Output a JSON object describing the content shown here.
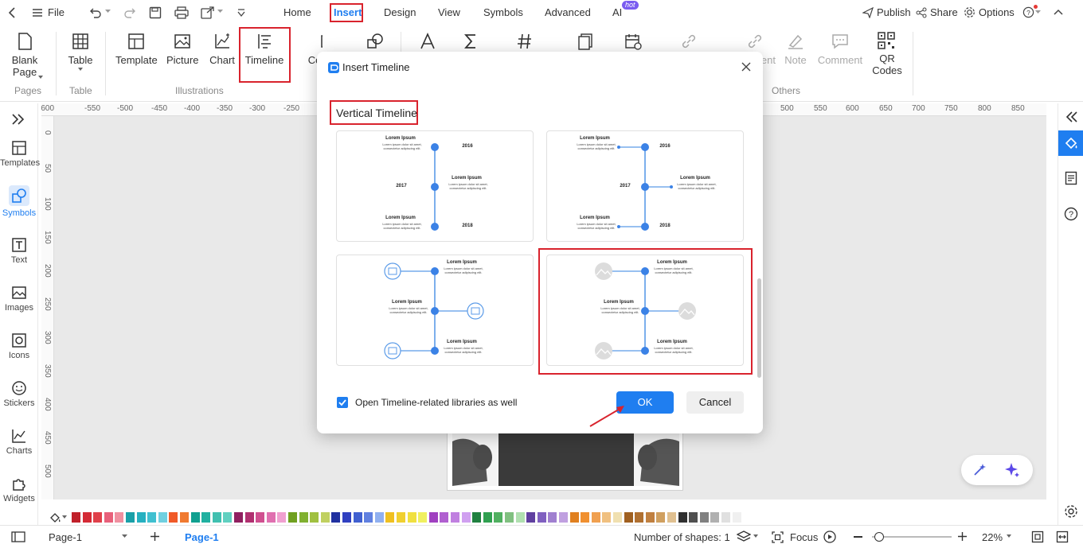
{
  "menu": {
    "file": "File",
    "tabs": [
      "Home",
      "Insert",
      "Design",
      "View",
      "Symbols",
      "Advanced",
      "AI"
    ],
    "hot_badge": "hot",
    "publish": "Publish",
    "share": "Share",
    "options": "Options"
  },
  "ribbon": {
    "blank_page": "Blank Page",
    "table": "Table",
    "template": "Template",
    "picture": "Picture",
    "chart": "Chart",
    "timeline": "Timeline",
    "partial_co": "Co",
    "partial_ent": "ent",
    "note": "Note",
    "comment": "Comment",
    "qr_codes": "QR Codes",
    "groups": {
      "pages": "Pages",
      "table": "Table",
      "illustrations": "Illustrations",
      "others": "Others"
    }
  },
  "sidebar": {
    "items": [
      "Templates",
      "Symbols",
      "Text",
      "Images",
      "Icons",
      "Stickers",
      "Charts",
      "Widgets"
    ]
  },
  "rulers": {
    "h_ticks": [
      "-600",
      "-550",
      "-500",
      "-450",
      "-400",
      "-350",
      "-300",
      "-250",
      "500",
      "550",
      "600",
      "650",
      "700",
      "750",
      "800",
      "850"
    ],
    "v_ticks": [
      "0",
      "50",
      "100",
      "150",
      "200",
      "250",
      "300",
      "350",
      "400",
      "450",
      "500"
    ]
  },
  "dialog": {
    "title": "Insert Timeline",
    "section": "Vertical Timeline",
    "lorem_title": "Lorem Ipsum",
    "lorem_text": "Lorem ipsum dolor sit amet, consectetur adipiscing elit.",
    "years": [
      "2016",
      "2017",
      "2018"
    ],
    "checkbox_label": "Open Timeline-related libraries as well",
    "checkbox_checked": true,
    "ok": "OK",
    "cancel": "Cancel"
  },
  "status": {
    "page_select": "Page-1",
    "page_tab": "Page-1",
    "shapes": "Number of shapes: 1",
    "focus": "Focus",
    "zoom": "22%"
  },
  "colors": {
    "accent": "#1f7ef0",
    "highlight": "#d9232d",
    "timeline": "#3b82e6",
    "palette": [
      "#c0202a",
      "#d42a35",
      "#e0404a",
      "#e8607a",
      "#f090a0",
      "#1aa0a8",
      "#26b0c0",
      "#40c0d0",
      "#70d0e0",
      "#f05a28",
      "#f07a30",
      "#10a090",
      "#20b0a0",
      "#40c0b0",
      "#60d0c0",
      "#902060",
      "#b03070",
      "#d05090",
      "#e070b0",
      "#f0a0d0",
      "#70a020",
      "#80b030",
      "#a0c040",
      "#c0d060",
      "#2030a0",
      "#3040c0",
      "#4060d0",
      "#6080e0",
      "#90b0f0",
      "#f0c020",
      "#f0d030",
      "#f0e040",
      "#f0f060",
      "#a040c0",
      "#b060d0",
      "#c080e0",
      "#d0a0f0",
      "#208040",
      "#30a050",
      "#50b060",
      "#80c080",
      "#b0e0b0",
      "#6040a0",
      "#8060c0",
      "#a080d0",
      "#c0a0e0",
      "#e08020",
      "#f09030",
      "#f0a050",
      "#f0c080",
      "#f0e0b0",
      "#a06020",
      "#b07030",
      "#c08040",
      "#d0a060",
      "#e0c090",
      "#303030",
      "#505050",
      "#808080",
      "#b0b0b0",
      "#e0e0e0",
      "#f0f0f0"
    ]
  }
}
